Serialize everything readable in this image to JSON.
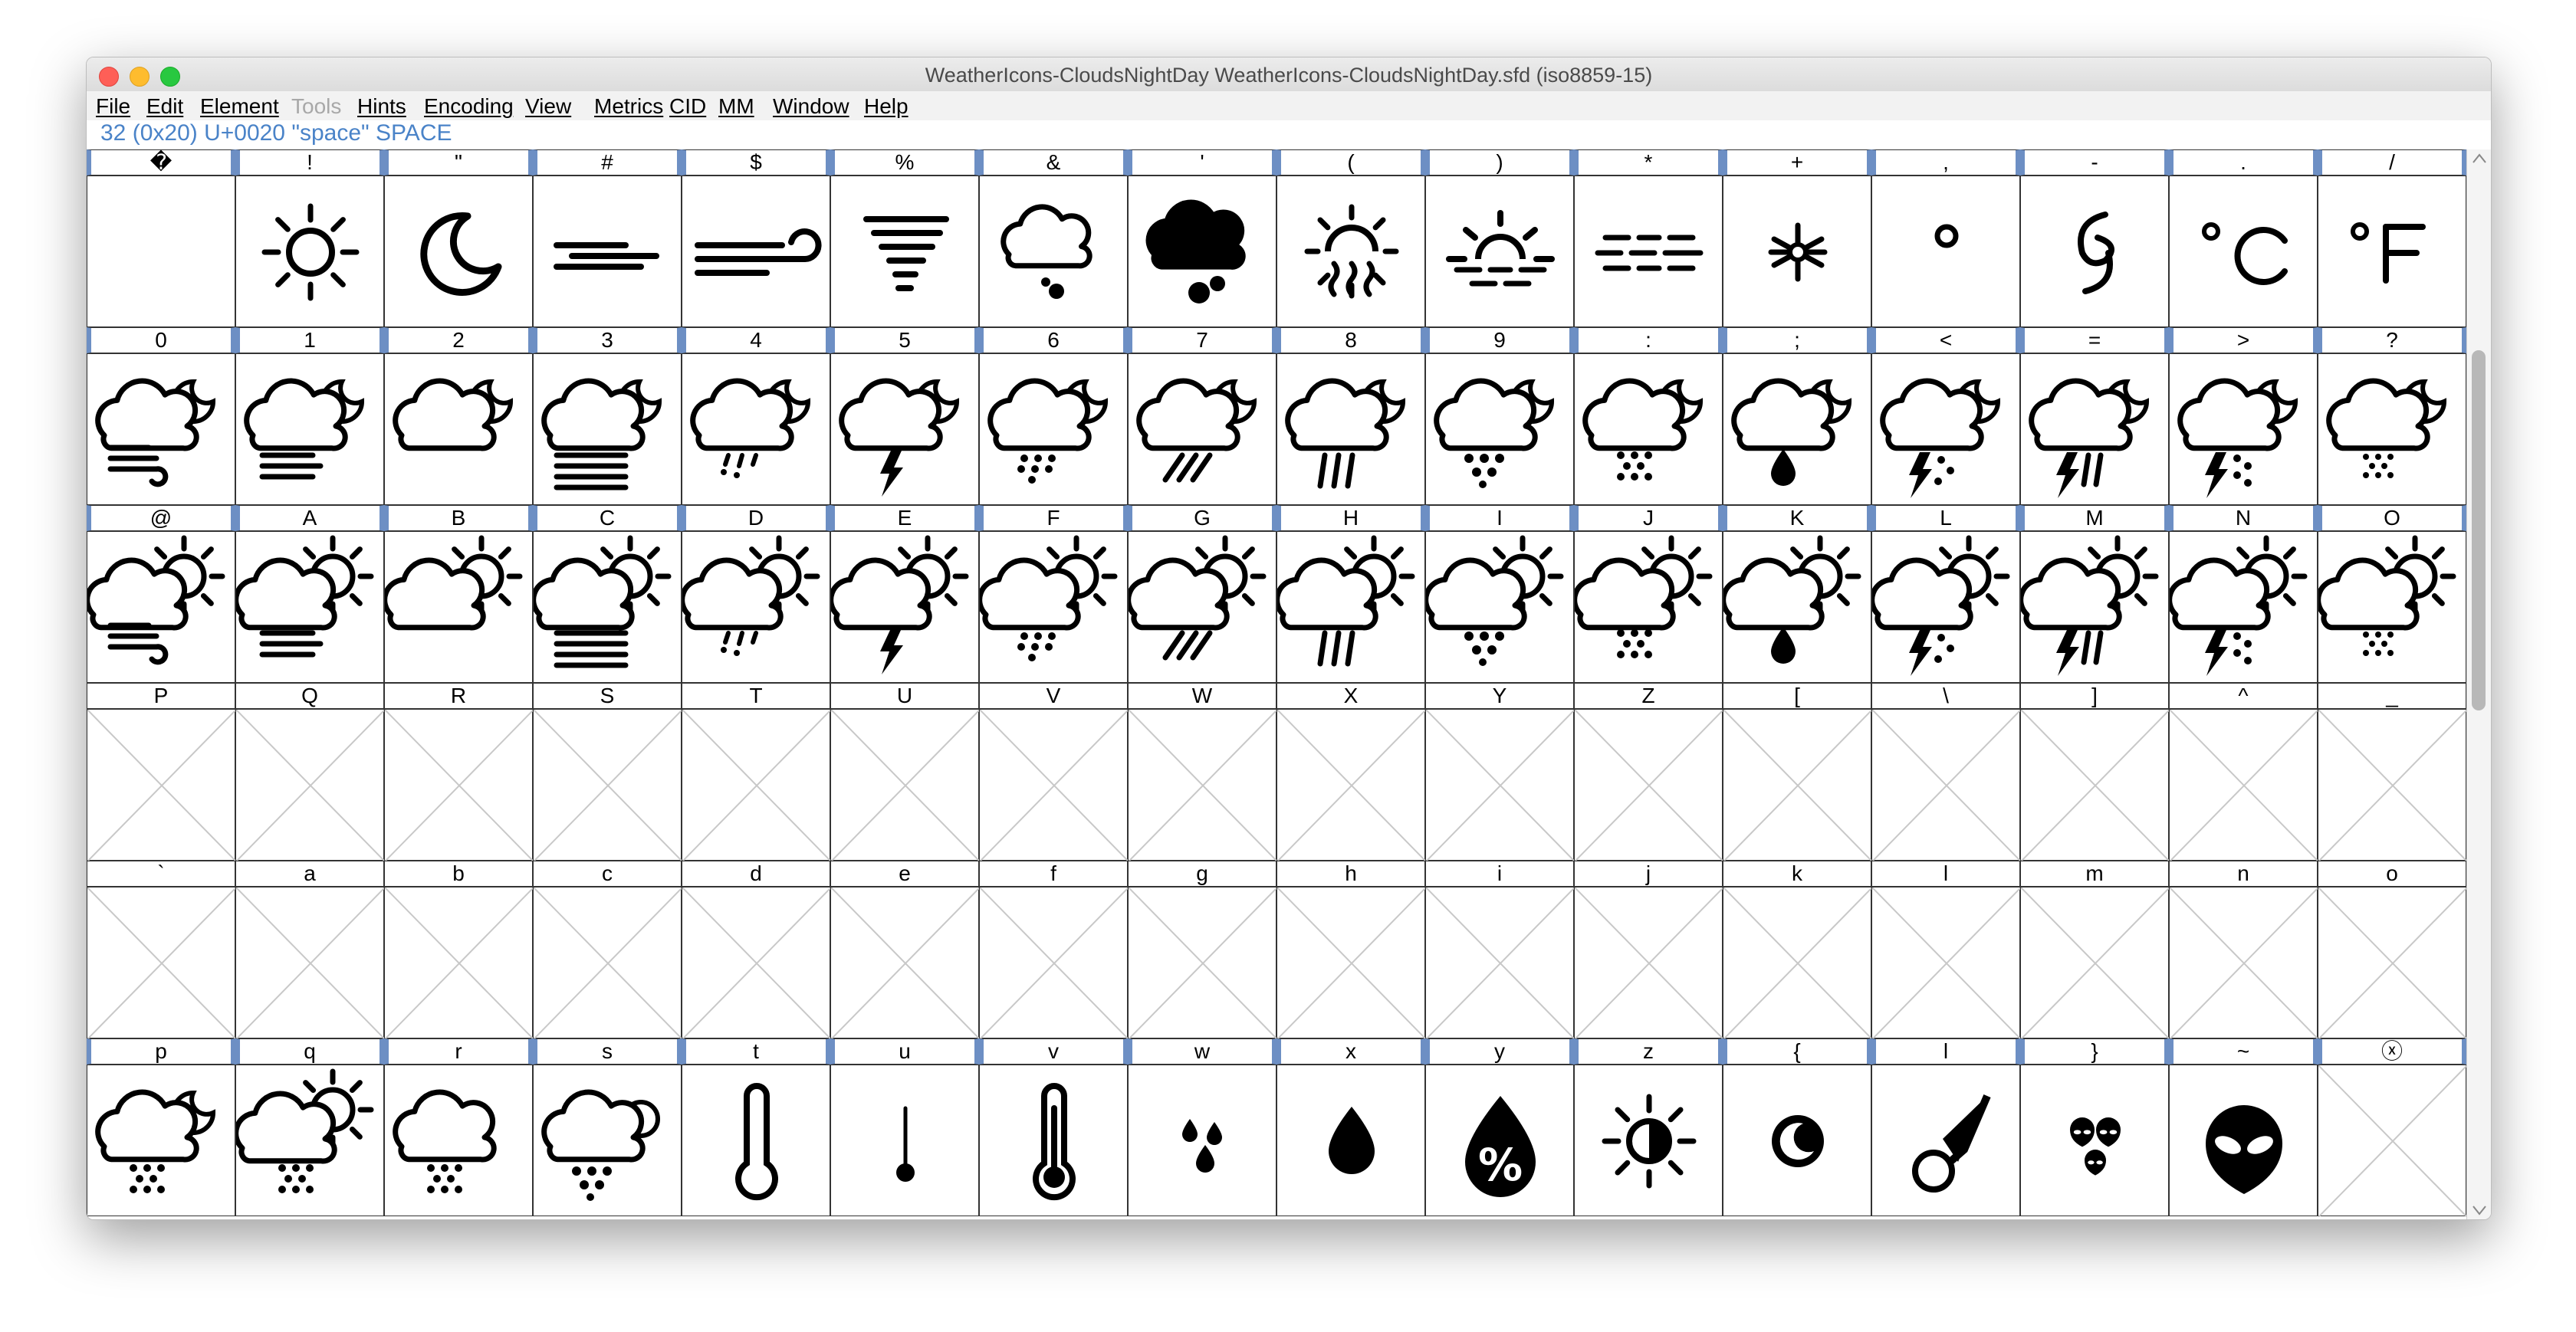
{
  "window": {
    "title": "WeatherIcons-CloudsNightDay  WeatherIcons-CloudsNightDay.sfd (iso8859-15)"
  },
  "menu": [
    {
      "label": "File",
      "enabled": true
    },
    {
      "label": "Edit",
      "enabled": true
    },
    {
      "label": "Element",
      "enabled": true
    },
    {
      "label": "Tools",
      "enabled": false
    },
    {
      "label": "Hints",
      "enabled": true
    },
    {
      "label": "Encoding",
      "enabled": true
    },
    {
      "label": "View",
      "enabled": true
    },
    {
      "label": "Metrics",
      "enabled": true
    },
    {
      "label": "CID",
      "enabled": true
    },
    {
      "label": "MM",
      "enabled": true
    },
    {
      "label": "Window",
      "enabled": true
    },
    {
      "label": "Help",
      "enabled": true
    }
  ],
  "status": "32 (0x20) U+0020 \"space\" SPACE",
  "rows": [
    {
      "labels": [
        "�",
        "!",
        "\"",
        "#",
        "$",
        "%",
        "&",
        "'",
        "(",
        ")",
        "*",
        "+",
        ",",
        "-",
        ".",
        "/"
      ],
      "glyphs": [
        "blank",
        "sun",
        "moon",
        "fog-lines",
        "wind",
        "tornado",
        "cloud-drops",
        "cloud-filled",
        "sunrise-haze",
        "sunset",
        "fog-dashes",
        "snowflake",
        "degree",
        "hurricane",
        "celsius",
        "fahrenheit"
      ]
    },
    {
      "labels": [
        "0",
        "1",
        "2",
        "3",
        "4",
        "5",
        "6",
        "7",
        "8",
        "9",
        ":",
        ";",
        "<",
        "=",
        ">",
        "?"
      ],
      "glyphs": [
        "night-wind",
        "night-fog",
        "night-cloud",
        "night-fog-heavy",
        "night-drizzle",
        "night-thunder",
        "night-rain",
        "night-rain-slant",
        "night-showers",
        "night-hail",
        "night-snow",
        "night-raindrop",
        "night-storm",
        "night-storm-rain",
        "night-storm-snow",
        "night-flurries"
      ]
    },
    {
      "labels": [
        "@",
        "A",
        "B",
        "C",
        "D",
        "E",
        "F",
        "G",
        "H",
        "I",
        "J",
        "K",
        "L",
        "M",
        "N",
        "O"
      ],
      "glyphs": [
        "day-wind",
        "day-fog",
        "day-cloud",
        "day-fog-heavy",
        "day-drizzle",
        "day-thunder",
        "day-rain",
        "day-rain-slant",
        "day-showers",
        "day-hail",
        "day-snow",
        "day-raindrop",
        "day-storm",
        "day-storm-rain",
        "day-storm-snow",
        "day-flurries"
      ]
    },
    {
      "labels": [
        "P",
        "Q",
        "R",
        "S",
        "T",
        "U",
        "V",
        "W",
        "X",
        "Y",
        "Z",
        "[",
        "\\",
        "]",
        "^",
        "_"
      ],
      "glyphs": [
        "empty",
        "empty",
        "empty",
        "empty",
        "empty",
        "empty",
        "empty",
        "empty",
        "empty",
        "empty",
        "empty",
        "empty",
        "empty",
        "empty",
        "empty",
        "empty"
      ]
    },
    {
      "labels": [
        "`",
        "a",
        "b",
        "c",
        "d",
        "e",
        "f",
        "g",
        "h",
        "i",
        "j",
        "k",
        "l",
        "m",
        "n",
        "o"
      ],
      "glyphs": [
        "empty",
        "empty",
        "empty",
        "empty",
        "empty",
        "empty",
        "empty",
        "empty",
        "empty",
        "empty",
        "empty",
        "empty",
        "empty",
        "empty",
        "empty",
        "empty"
      ]
    },
    {
      "labels": [
        "p",
        "q",
        "r",
        "s",
        "t",
        "u",
        "v",
        "w",
        "x",
        "y",
        "z",
        "{",
        "l",
        "}",
        "~",
        "ⓧ"
      ],
      "glyphs": [
        "night-cloud-snow",
        "day-cloud-snow",
        "cloud-snow",
        "cloud-hail",
        "thermometer",
        "thermometer-low",
        "thermometer-full",
        "raindrops",
        "raindrop",
        "humidity",
        "sun-moon",
        "moon-disc",
        "meteor",
        "aliens",
        "alien",
        "empty"
      ]
    }
  ],
  "selected_rows": [
    0,
    1,
    2,
    5
  ]
}
